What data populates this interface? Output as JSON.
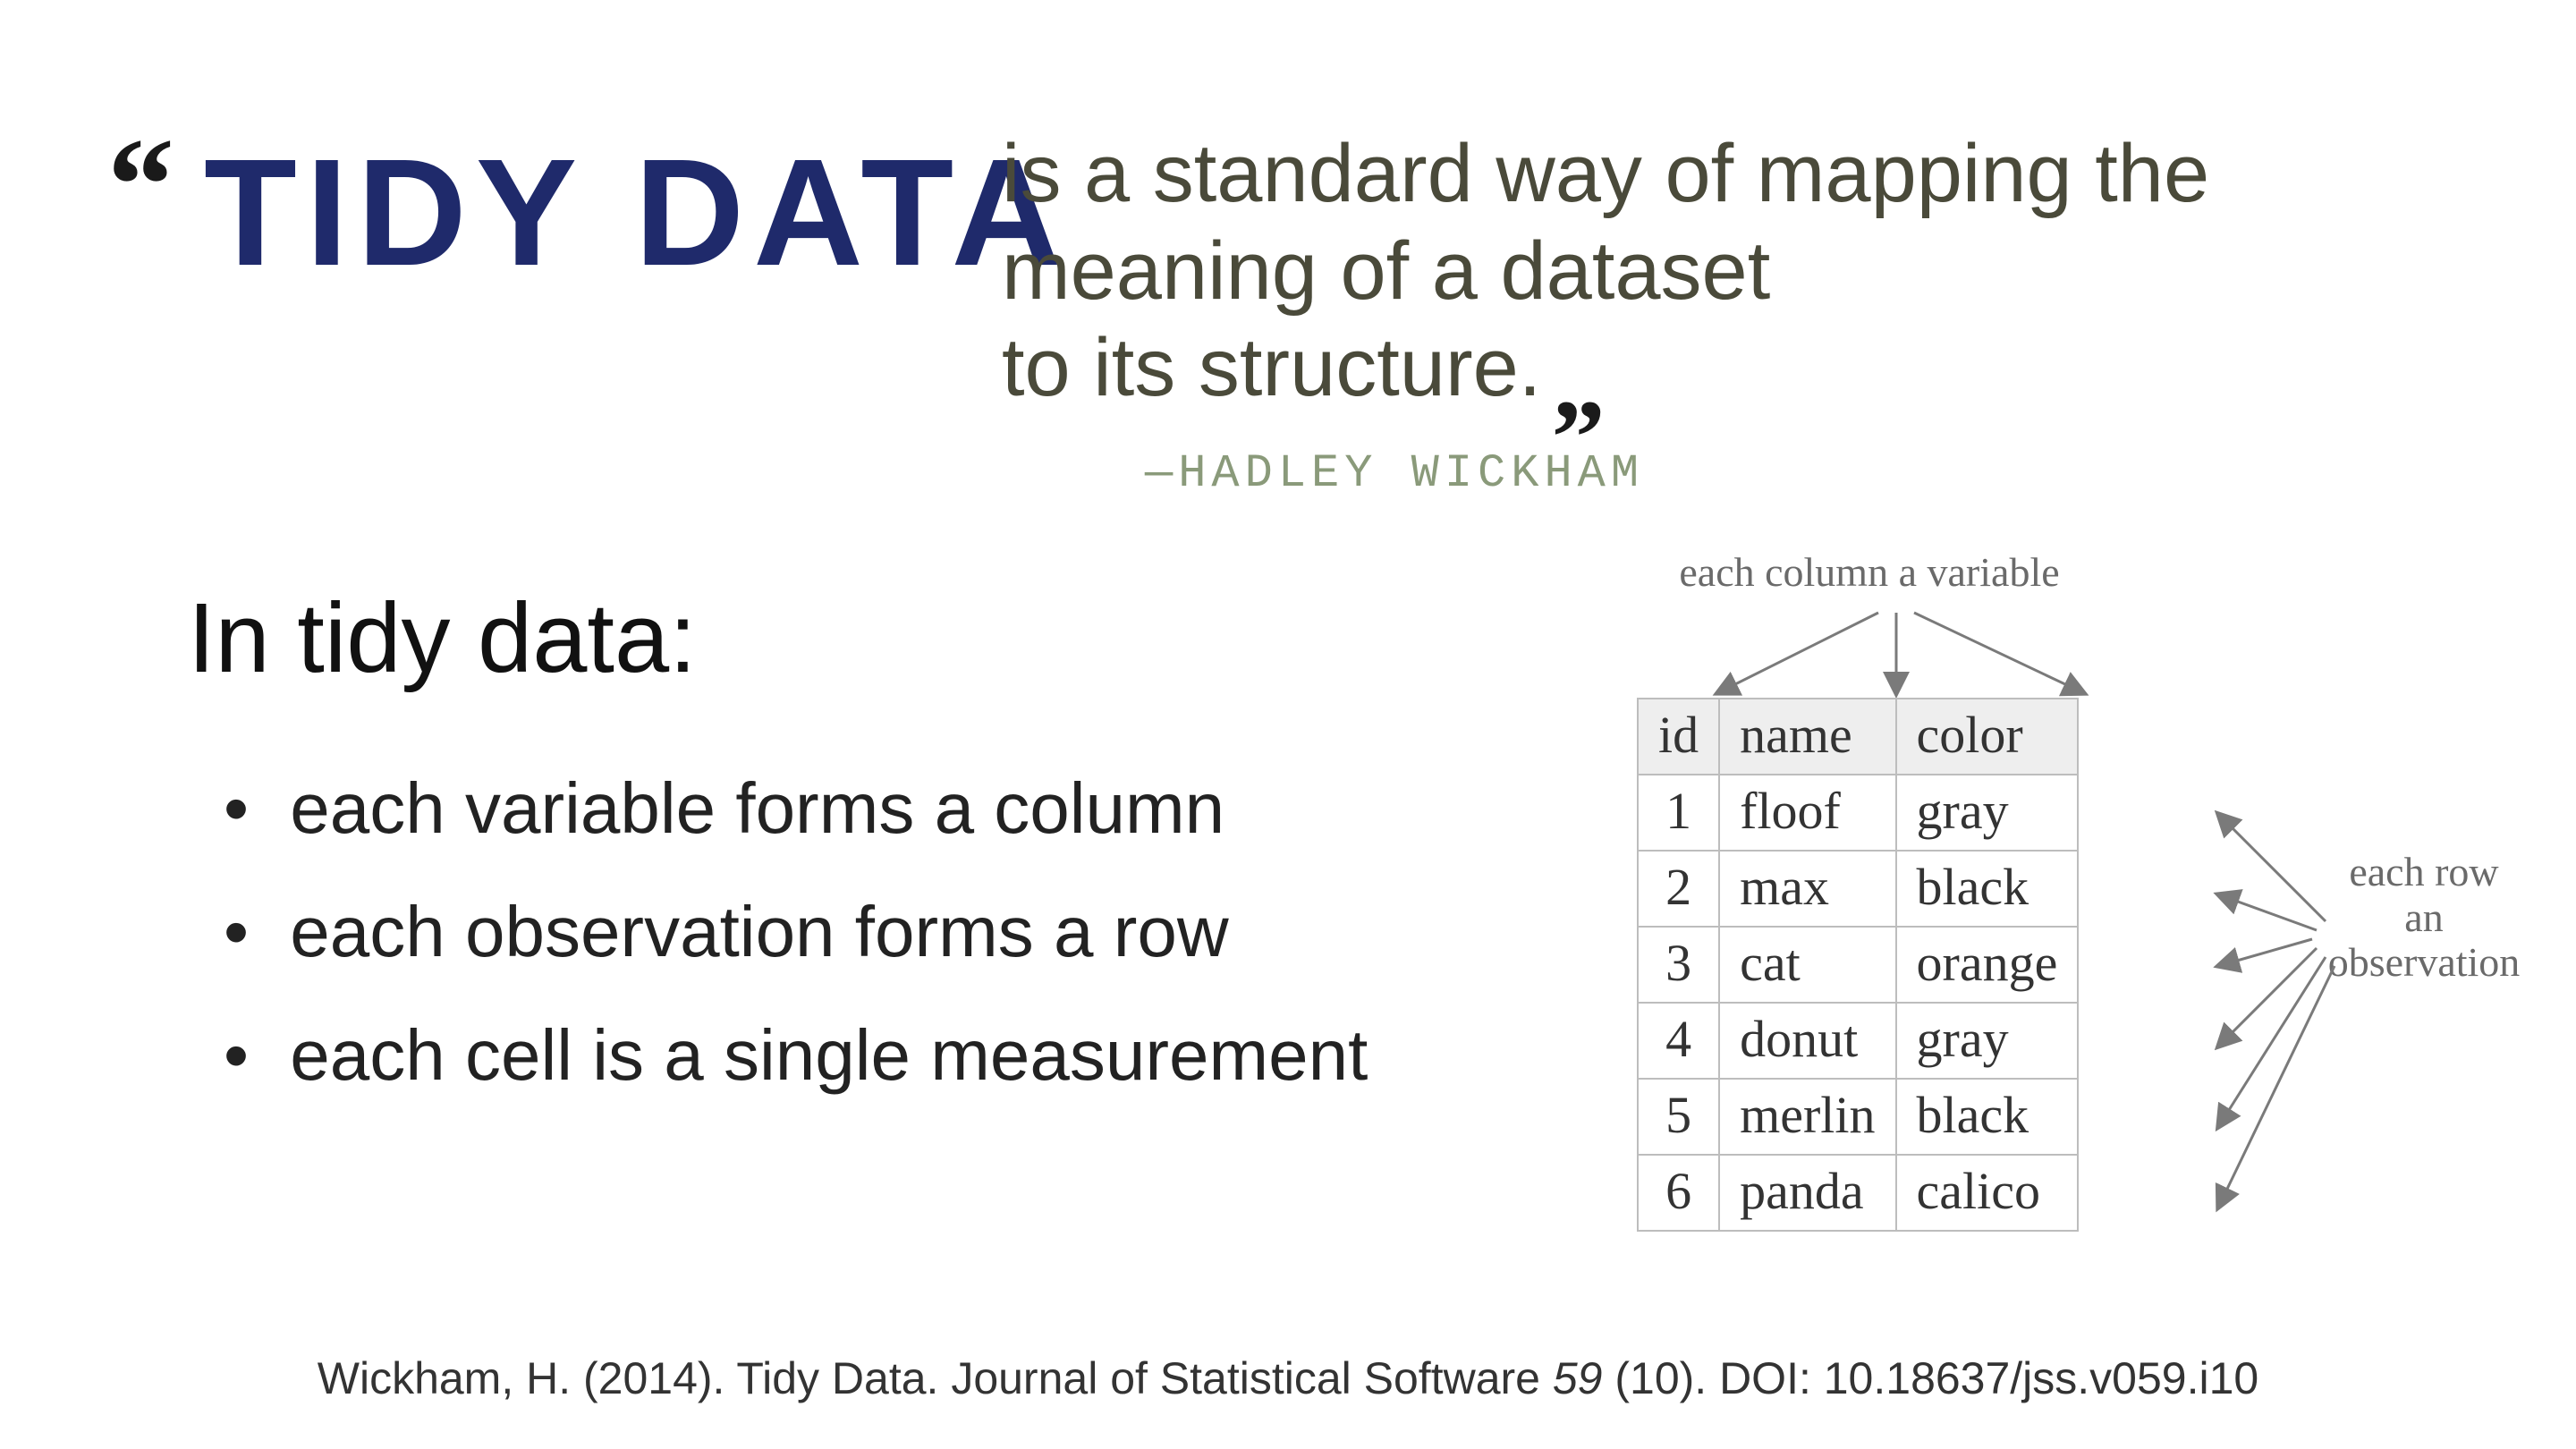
{
  "quote": {
    "title": "TIDY DATA",
    "line1_pre": "is a standard way of mapping the",
    "line2_pre": "",
    "line2_hl": "meaning",
    "line2_post": " of a dataset",
    "line3_pre": "to its ",
    "line3_hl": "structure",
    "line3_post": ".",
    "attribution": "—HADLEY WICKHAM"
  },
  "section_heading": "In tidy data:",
  "bullets": [
    {
      "pre": "each ",
      "hl1": "variable",
      "hl1_color": "yellow",
      "mid": " forms a ",
      "hl2": "column",
      "hl2_color": "yellow",
      "post": ""
    },
    {
      "pre": "each ",
      "hl1": "observation",
      "hl1_color": "green",
      "mid": " forms a ",
      "hl2": "row",
      "hl2_color": "green",
      "post": ""
    },
    {
      "pre": "each ",
      "hl1": "cell",
      "hl1_color": "teal",
      "mid": " is a ",
      "hl2": "single measurement",
      "hl2_color": "teal",
      "post": ""
    }
  ],
  "table": {
    "headers": [
      "id",
      "name",
      "color"
    ],
    "rows": [
      [
        "1",
        "floof",
        "gray"
      ],
      [
        "2",
        "max",
        "black"
      ],
      [
        "3",
        "cat",
        "orange"
      ],
      [
        "4",
        "donut",
        "gray"
      ],
      [
        "5",
        "merlin",
        "black"
      ],
      [
        "6",
        "panda",
        "calico"
      ]
    ]
  },
  "annotations": {
    "columns": "each column a variable",
    "rows_l1": "each row",
    "rows_l2": "an",
    "rows_l3": "observation"
  },
  "citation": {
    "author": "Wickham, H. (2014). Tidy Data. ",
    "journal": "Journal of Statistical Software ",
    "volume": "59",
    "issue": " (10). DOI: 10.18637/jss.v059.i10"
  }
}
